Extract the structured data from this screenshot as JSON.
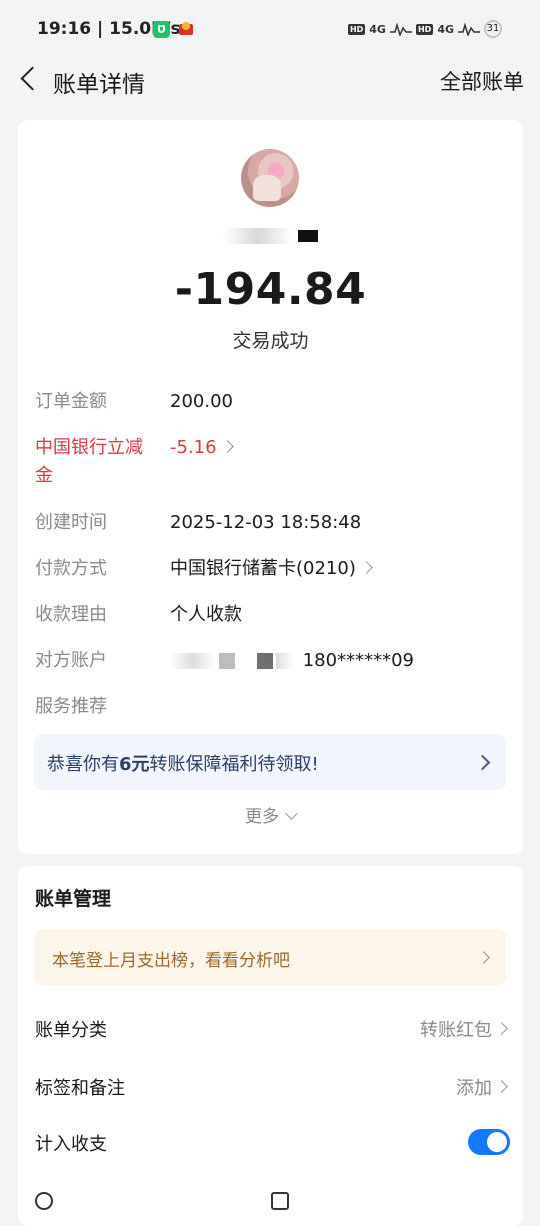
{
  "status_bar": {
    "time": "19:16 | 15.0K/s",
    "signal1": "4G",
    "signal2": "4G",
    "battery": "31"
  },
  "header": {
    "title": "账单详情",
    "right_link": "全部账单"
  },
  "summary": {
    "amount": "-194.84",
    "status": "交易成功"
  },
  "details": {
    "order_amount_label": "订单金额",
    "order_amount_value": "200.00",
    "discount_label": "中国银行立减金",
    "discount_value": "-5.16",
    "created_label": "创建时间",
    "created_value": "2025-12-03 18:58:48",
    "payment_label": "付款方式",
    "payment_value": "中国银行储蓄卡(0210)",
    "reason_label": "收款理由",
    "reason_value": "个人收款",
    "counterparty_label": "对方账户",
    "counterparty_value": "180******09",
    "service_label": "服务推荐"
  },
  "promo": {
    "text_prefix": "恭喜你有",
    "text_bold": "6元",
    "text_suffix": "转账保障福利待领取!"
  },
  "more_label": "更多",
  "management": {
    "title": "账单管理",
    "tip": "本笔登上月支出榜，看看分析吧",
    "category_label": "账单分类",
    "category_value": "转账红包",
    "tags_label": "标签和备注",
    "tags_value": "添加",
    "count_label": "计入收支",
    "count_enabled": true
  },
  "colors": {
    "accent": "#1677ff",
    "red": "#d93a43",
    "background": "#f2f3f5"
  }
}
